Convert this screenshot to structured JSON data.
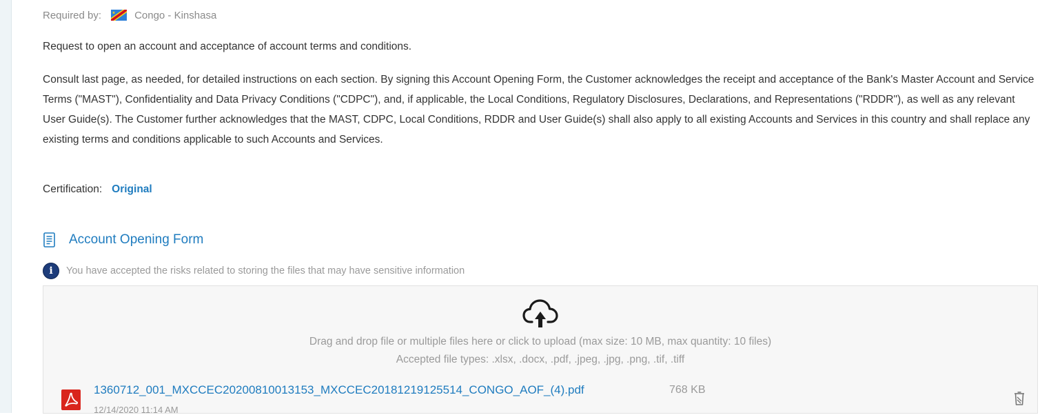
{
  "header": {
    "required_by_label": "Required by:",
    "country": "Congo - Kinshasa",
    "flag_icon": "drc-flag-icon"
  },
  "intro": {
    "request_text": "Request to open an account and acceptance of account terms and conditions.",
    "consult_text": "Consult last page, as needed, for detailed instructions on each section. By signing this Account Opening Form, the Customer acknowledges the receipt and acceptance of the Bank's Master Account and Service Terms (\"MAST\"), Confidentiality and Data Privacy Conditions (\"CDPC\"), and, if applicable, the Local Conditions, Regulatory Disclosures, Declarations, and Representations (\"RDDR\"), as well as any relevant User Guide(s). The Customer further acknowledges that the MAST, CDPC, Local Conditions, RDDR and User Guide(s) shall also apply to all existing Accounts and Services in this country and shall replace any existing terms and conditions applicable to such Accounts and Services."
  },
  "certification": {
    "label": "Certification:",
    "value": "Original"
  },
  "form": {
    "title": "Account Opening Form",
    "info_text": "You have accepted the risks related to storing the files that may have sensitive information",
    "info_icon_glyph": "i"
  },
  "upload": {
    "instruction": "Drag and drop file or multiple files here or click to upload (max size: 10 MB, max quantity: 10 files)",
    "accepted_types": "Accepted file types: .xlsx, .docx, .pdf, .jpeg, .jpg, .png, .tif, .tiff"
  },
  "files": [
    {
      "name": "1360712_001_MXCCEC20200810013153_MXCCEC20181219125514_CONGO_AOF_(4).pdf",
      "size": "768 KB",
      "date": "12/14/2020 11:14 AM"
    }
  ],
  "colors": {
    "link_blue": "#1f7cbf",
    "muted_text": "#9a9a9a",
    "body_text": "#333333",
    "info_icon_bg": "#1d3c7a",
    "pdf_red": "#d9251c"
  }
}
